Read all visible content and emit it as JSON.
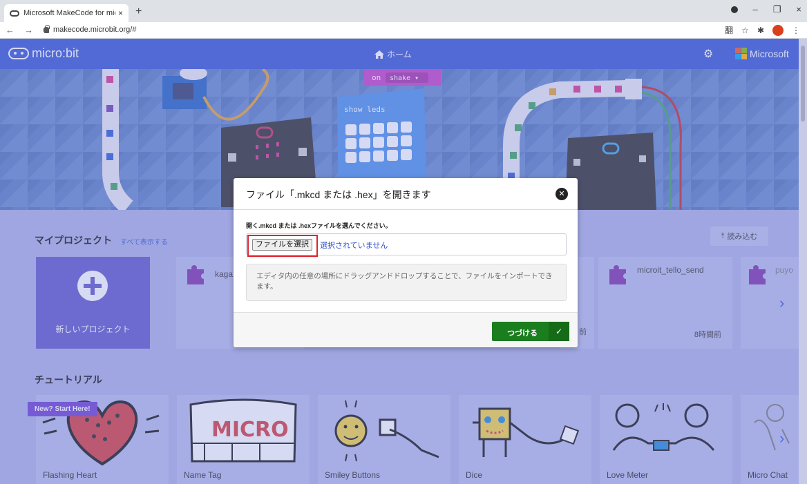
{
  "browser": {
    "tab_title": "Microsoft MakeCode for micro:b",
    "tab_close": "×",
    "new_tab": "+",
    "url": "makecode.microbit.org/#",
    "nav_back": "←",
    "nav_forward": "→",
    "nav_reload": "C",
    "window_controls": [
      "–",
      "❐",
      "×"
    ],
    "ext_icons": [
      "翻",
      "☆",
      "✱"
    ]
  },
  "header": {
    "logo": "micro:bit",
    "home": "ホーム",
    "home_icon": "home-icon",
    "settings_icon": "gear-icon",
    "brand": "Microsoft"
  },
  "hero": {
    "block_on": "on",
    "block_shake": "shake ▾",
    "block_show_leds": "show leds"
  },
  "projects": {
    "title": "マイプロジェクト",
    "see_all": "すべて表示する",
    "import": "読み込む",
    "new_project": "新しいプロジェクト",
    "items": [
      {
        "title": "kaga",
        "time": ""
      },
      {
        "title": "microit_tello_send",
        "time": "8時間前"
      },
      {
        "title": "puyo",
        "time": ""
      }
    ],
    "hidden_time_fragment": "前",
    "chevron": "›"
  },
  "tutorials": {
    "title": "チュートリアル",
    "badge": "New? Start Here!",
    "items": [
      "Flashing Heart",
      "Name Tag",
      "Smiley Buttons",
      "Dice",
      "Love Meter",
      "Micro Chat"
    ],
    "chevron": "›"
  },
  "modal": {
    "title": "ファイル「.mkcd または .hex」を開きます",
    "close": "✕",
    "prompt": "開く.mkcd または .hexファイルを選んでください。",
    "choose_file": "ファイルを選択",
    "no_file": "選択されていません",
    "hint": "エディタ内の任意の場所にドラッグアンドドロップすることで、ファイルをインポートできます。",
    "go": "つづける",
    "go_check": "✓"
  },
  "colors": {
    "header_blue": "#3454d1",
    "new_project_purple": "#5e55c9",
    "go_green": "#1a7d1e",
    "highlight_red": "#e0222c"
  }
}
